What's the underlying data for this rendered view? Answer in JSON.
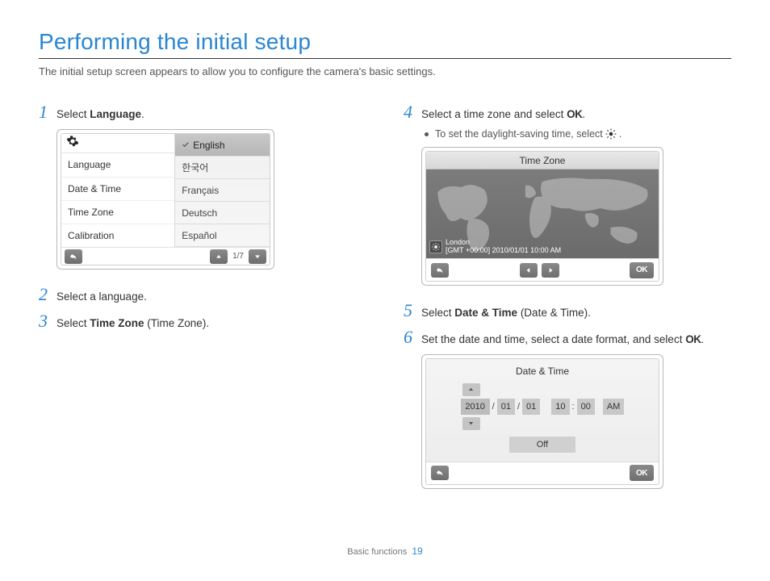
{
  "title": "Performing the initial setup",
  "intro": "The initial setup screen appears to allow you to configure the camera's basic settings.",
  "steps": {
    "s1": {
      "num": "1",
      "pre": "Select ",
      "bold": "Language",
      "post": "."
    },
    "s2": {
      "num": "2",
      "text": "Select a language."
    },
    "s3": {
      "num": "3",
      "pre": "Select ",
      "bold": "Time Zone",
      "post": " (Time Zone)."
    },
    "s4": {
      "num": "4",
      "pre": "Select a time zone and select ",
      "ok": "OK",
      "post": ".",
      "bullet": {
        "pre": "To set the daylight-saving time, select ",
        "post": "."
      }
    },
    "s5": {
      "num": "5",
      "pre": "Select ",
      "bold": "Date & Time",
      "post": " (Date & Time)."
    },
    "s6": {
      "num": "6",
      "pre": "Set the date and time, select a date format, and select ",
      "ok": "OK",
      "post": "."
    }
  },
  "langMenu": {
    "leftItems": [
      "Language",
      "Date & Time",
      "Time Zone",
      "Calibration"
    ],
    "options": [
      "English",
      "한국어",
      "Français",
      "Deutsch",
      "Español"
    ],
    "selectedIndex": 0,
    "pageIndicator": "1/7"
  },
  "timezone": {
    "title": "Time Zone",
    "city": "London",
    "detail": "[GMT +00:00] 2010/01/01 10:00 AM",
    "okLabel": "OK"
  },
  "datetime": {
    "title": "Date & Time",
    "year": "2010",
    "month": "01",
    "day": "01",
    "hour": "10",
    "minute": "00",
    "ampm": "AM",
    "dst": "Off",
    "okLabel": "OK"
  },
  "footer": {
    "section": "Basic functions",
    "page": "19"
  }
}
